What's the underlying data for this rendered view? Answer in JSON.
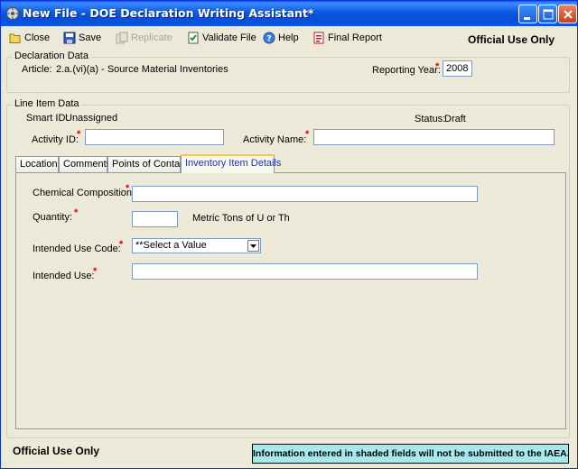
{
  "window": {
    "title": "New File - DOE Declaration Writing Assistant*"
  },
  "toolbar": {
    "close_label": "Close",
    "save_label": "Save",
    "replicate_label": "Replicate",
    "validate_label": "Validate File",
    "help_label": "Help",
    "final_report_label": "Final Report",
    "classification": "Official Use Only"
  },
  "declaration": {
    "group_title": "Declaration Data",
    "article_label": "Article:",
    "article_value": "2.a.(vi)(a) - Source Material Inventories",
    "reporting_year_label": "Reporting Year:",
    "reporting_year_value": "2008",
    "required_mark": "*"
  },
  "line_item": {
    "group_title": "Line Item Data",
    "smart_id_label": "Smart ID:",
    "smart_id_value": "Unassigned",
    "status_label": "Status:",
    "status_value": "Draft",
    "activity_id_label": "Activity ID:",
    "activity_id_value": "",
    "activity_name_label": "Activity Name:",
    "activity_name_value": ""
  },
  "tabs": [
    {
      "label": "Location"
    },
    {
      "label": "Comments"
    },
    {
      "label": "Points of Contact"
    },
    {
      "label": "Inventory Item Details"
    }
  ],
  "inventory": {
    "chemical_composition_label": "Chemical Composition:",
    "chemical_composition_value": "",
    "quantity_label": "Quantity:",
    "quantity_value": "",
    "quantity_units": "Metric Tons of U or Th",
    "intended_use_code_label": "Intended Use Code:",
    "intended_use_code_value": "**Select a Value",
    "intended_use_label": "Intended Use:",
    "intended_use_value": ""
  },
  "footer": {
    "classification": "Official Use Only",
    "info_text": "Information entered in shaded fields will not be submitted to the IAEA."
  },
  "colors": {
    "titlebar": "#0a5ae0",
    "required": "#e00000",
    "info_box": "#a8e8ec",
    "active_tab_text": "#1c3c9c"
  }
}
